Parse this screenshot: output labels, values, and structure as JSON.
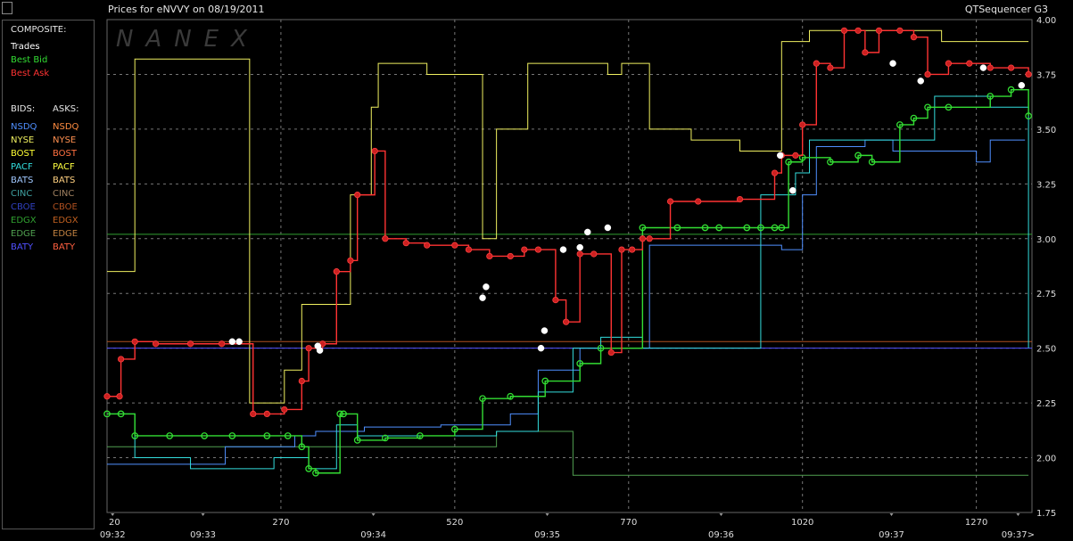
{
  "window": {
    "title": "Prices for  eNVVY  on  08/19/2011",
    "app_name": "QTSequencer G3"
  },
  "legend": {
    "composite_header": "COMPOSITE:",
    "composite": [
      {
        "label": "Trades",
        "color": "#ffffff"
      },
      {
        "label": "Best Bid",
        "color": "#33dd33"
      },
      {
        "label": "Best Ask",
        "color": "#ff3333"
      }
    ],
    "bids_header": "BIDS:",
    "asks_header": "ASKS:",
    "exchanges": [
      {
        "bid": "NSDQ",
        "bid_color": "#4f8fff",
        "ask": "NSDQ",
        "ask_color": "#ff8c40"
      },
      {
        "bid": "NYSE",
        "bid_color": "#f0f060",
        "ask": "NYSE",
        "ask_color": "#ff9050"
      },
      {
        "bid": "BOST",
        "bid_color": "#ffff33",
        "ask": "BOST",
        "ask_color": "#ff7040"
      },
      {
        "bid": "PACF",
        "bid_color": "#33dddd",
        "ask": "PACF",
        "ask_color": "#ffff40"
      },
      {
        "bid": "BATS",
        "bid_color": "#a0c8ff",
        "ask": "BATS",
        "ask_color": "#ffd080"
      },
      {
        "bid": "CINC",
        "bid_color": "#3fa0a0",
        "ask": "CINC",
        "ask_color": "#a08060"
      },
      {
        "bid": "CBOE",
        "bid_color": "#3040c0",
        "ask": "CBOE",
        "ask_color": "#b05020"
      },
      {
        "bid": "EDGX",
        "bid_color": "#30a030",
        "ask": "EDGX",
        "ask_color": "#c06020"
      },
      {
        "bid": "EDGE",
        "bid_color": "#50a050",
        "ask": "EDGE",
        "ask_color": "#c08040"
      },
      {
        "bid": "BATY",
        "bid_color": "#5050ff",
        "ask": "BATY",
        "ask_color": "#ff6040"
      }
    ]
  },
  "watermark": "NANEX",
  "chart_data": {
    "type": "line",
    "ylim": [
      1.75,
      4.0
    ],
    "yticks": [
      "4.00",
      "3.75",
      "3.50",
      "3.25",
      "3.00",
      "2.75",
      "2.50",
      "2.25",
      "2.00",
      "1.75"
    ],
    "xlim": [
      20,
      1350
    ],
    "xticks": [
      "20",
      "270",
      "520",
      "770",
      "1020",
      "1270"
    ],
    "time_labels": [
      {
        "x": 28,
        "label": "09:32"
      },
      {
        "x": 158,
        "label": "09:33"
      },
      {
        "x": 403,
        "label": "09:34"
      },
      {
        "x": 653,
        "label": "09:35"
      },
      {
        "x": 903,
        "label": "09:36"
      },
      {
        "x": 1148,
        "label": "09:37"
      },
      {
        "x": 1330,
        "label": "09:37>"
      }
    ],
    "grid": true,
    "series": [
      {
        "name": "Best Ask",
        "color": "#ff3333",
        "x": [
          20,
          38,
          40,
          60,
          90,
          140,
          185,
          230,
          250,
          275,
          300,
          310,
          330,
          350,
          370,
          380,
          405,
          420,
          450,
          480,
          520,
          540,
          570,
          600,
          620,
          640,
          665,
          680,
          700,
          720,
          745,
          760,
          775,
          790,
          800,
          830,
          870,
          930,
          980,
          990,
          1010,
          1020,
          1040,
          1060,
          1080,
          1100,
          1110,
          1130,
          1160,
          1180,
          1200,
          1230,
          1260,
          1290,
          1320,
          1345
        ],
        "y": [
          2.28,
          2.28,
          2.45,
          2.53,
          2.52,
          2.52,
          2.52,
          2.2,
          2.2,
          2.22,
          2.35,
          2.5,
          2.52,
          2.85,
          2.9,
          3.2,
          3.4,
          3.0,
          2.98,
          2.97,
          2.97,
          2.95,
          2.92,
          2.92,
          2.95,
          2.95,
          2.72,
          2.62,
          2.93,
          2.93,
          2.48,
          2.95,
          2.95,
          3.0,
          3.0,
          3.17,
          3.17,
          3.18,
          3.3,
          3.38,
          3.38,
          3.52,
          3.8,
          3.78,
          3.95,
          3.95,
          3.85,
          3.95,
          3.95,
          3.92,
          3.75,
          3.8,
          3.8,
          3.78,
          3.78,
          3.75
        ]
      },
      {
        "name": "Best Bid",
        "color": "#33dd33",
        "x": [
          20,
          40,
          60,
          110,
          160,
          200,
          250,
          280,
          300,
          310,
          320,
          355,
          360,
          380,
          420,
          470,
          520,
          560,
          600,
          650,
          700,
          730,
          790,
          840,
          880,
          900,
          940,
          960,
          980,
          990,
          1000,
          1020,
          1060,
          1100,
          1120,
          1160,
          1180,
          1200,
          1230,
          1290,
          1320,
          1345
        ],
        "y": [
          2.2,
          2.2,
          2.1,
          2.1,
          2.1,
          2.1,
          2.1,
          2.1,
          2.05,
          1.95,
          1.93,
          2.2,
          2.2,
          2.08,
          2.09,
          2.1,
          2.13,
          2.27,
          2.28,
          2.35,
          2.43,
          2.5,
          3.05,
          3.05,
          3.05,
          3.05,
          3.05,
          3.05,
          3.05,
          3.05,
          3.35,
          3.37,
          3.35,
          3.38,
          3.35,
          3.52,
          3.55,
          3.6,
          3.6,
          3.65,
          3.68,
          3.56
        ]
      },
      {
        "name": "NSDQ",
        "color": "#4f8fff",
        "x": [
          20,
          120,
          190,
          230,
          290,
          320,
          390,
          500,
          600,
          640,
          700,
          800,
          860,
          990,
          1020,
          1040,
          1110,
          1150,
          1270,
          1290,
          1340
        ],
        "y": [
          1.97,
          1.97,
          2.05,
          2.05,
          2.1,
          2.12,
          2.14,
          2.15,
          2.2,
          2.4,
          2.5,
          2.97,
          2.97,
          2.95,
          3.2,
          3.42,
          3.45,
          3.4,
          3.35,
          3.45,
          3.45
        ]
      },
      {
        "name": "PACF",
        "color": "#33dddd",
        "x": [
          20,
          60,
          100,
          140,
          190,
          230,
          260,
          310,
          350,
          380,
          420,
          520,
          580,
          640,
          690,
          730,
          790,
          880,
          960,
          1010,
          1030,
          1070,
          1180,
          1210,
          1240,
          1290,
          1345
        ],
        "y": [
          2.2,
          2.0,
          2.0,
          1.95,
          1.95,
          1.95,
          2.0,
          1.95,
          2.15,
          2.1,
          2.1,
          2.1,
          2.12,
          2.3,
          2.5,
          2.55,
          2.5,
          2.5,
          3.2,
          3.3,
          3.45,
          3.45,
          3.45,
          3.65,
          3.65,
          3.6,
          2.5
        ]
      },
      {
        "name": "NYSE",
        "color": "#f0f060",
        "x": [
          20,
          60,
          70,
          140,
          190,
          225,
          275,
          300,
          370,
          400,
          410,
          480,
          560,
          580,
          625,
          640,
          700,
          740,
          760,
          800,
          860,
          930,
          990,
          1030,
          1060,
          1160,
          1220,
          1345
        ],
        "y": [
          2.85,
          3.82,
          3.82,
          3.82,
          3.82,
          2.25,
          2.4,
          2.7,
          3.2,
          3.6,
          3.8,
          3.75,
          3.0,
          3.5,
          3.8,
          3.8,
          3.8,
          3.75,
          3.8,
          3.5,
          3.45,
          3.4,
          3.9,
          3.95,
          3.95,
          3.95,
          3.9,
          3.9
        ]
      },
      {
        "name": "EDGE",
        "color": "#50a050",
        "x": [
          20,
          220,
          420,
          560,
          580,
          630,
          690,
          690,
          1000,
          1345
        ],
        "y": [
          2.05,
          2.05,
          2.05,
          2.05,
          2.12,
          2.12,
          2.12,
          1.92,
          1.92,
          1.92
        ]
      }
    ],
    "flat_lines": [
      {
        "name": "EDGX",
        "color": "#30a030",
        "y": 3.02
      },
      {
        "name": "BATY",
        "color": "#5050ff",
        "y": 2.5
      },
      {
        "name": "CBOE",
        "color": "#b05020",
        "y": 2.53
      }
    ],
    "trades": [
      {
        "x": 200,
        "y": 2.53
      },
      {
        "x": 210,
        "y": 2.53
      },
      {
        "x": 323,
        "y": 2.51
      },
      {
        "x": 326,
        "y": 2.49
      },
      {
        "x": 565,
        "y": 2.78
      },
      {
        "x": 560,
        "y": 2.73
      },
      {
        "x": 644,
        "y": 2.5
      },
      {
        "x": 649,
        "y": 2.58
      },
      {
        "x": 676,
        "y": 2.95
      },
      {
        "x": 700,
        "y": 2.96
      },
      {
        "x": 711,
        "y": 3.03
      },
      {
        "x": 740,
        "y": 3.05
      },
      {
        "x": 988,
        "y": 3.38
      },
      {
        "x": 1006,
        "y": 3.22
      },
      {
        "x": 1150,
        "y": 3.8
      },
      {
        "x": 1190,
        "y": 3.72
      },
      {
        "x": 1280,
        "y": 3.78
      },
      {
        "x": 1335,
        "y": 3.7
      }
    ]
  }
}
